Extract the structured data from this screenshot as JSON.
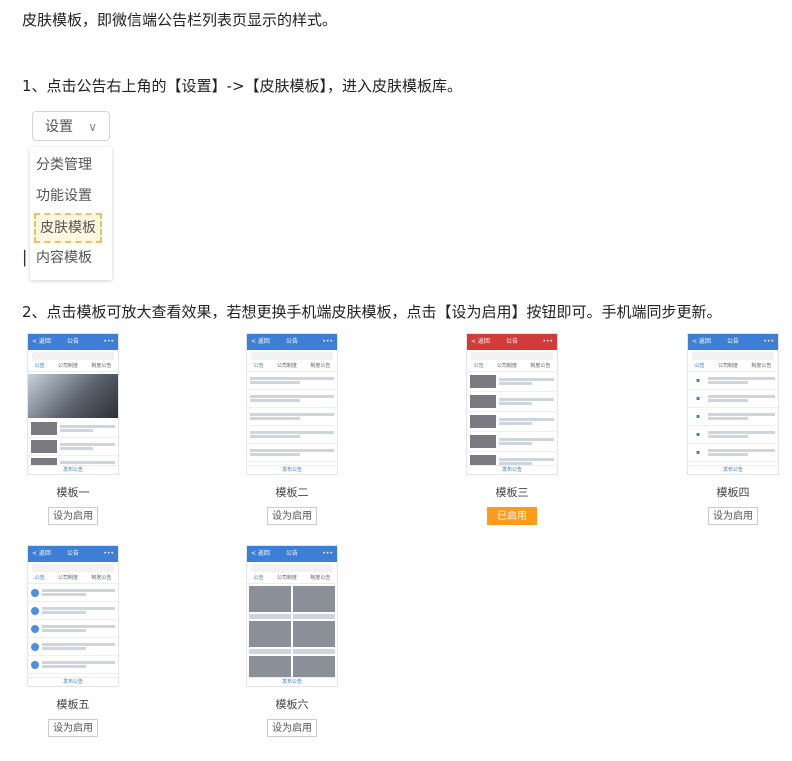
{
  "intro": "皮肤模板，即微信端公告栏列表页显示的样式。",
  "step1": "1、点击公告右上角的【设置】->【皮肤模板】，进入皮肤模板库。",
  "settings": {
    "button_label": "设置",
    "chevron": "∨",
    "menu": [
      "分类管理",
      "功能设置",
      "皮肤模板",
      "内容模板"
    ],
    "highlighted_index": 2
  },
  "step2": "2、点击模板可放大查看效果，若想更换手机端皮肤模板，点击【设为启用】按钮即可。手机端同步更新。",
  "phone": {
    "back": "< 返回",
    "title": "公告",
    "more": "•••",
    "tabs": [
      "公告",
      "公司制度",
      "制度公告"
    ],
    "footer": "发布公告"
  },
  "templates": [
    {
      "name": "模板一",
      "button": "设为启用",
      "active": false
    },
    {
      "name": "模板二",
      "button": "设为启用",
      "active": false
    },
    {
      "name": "模板三",
      "button": "已启用",
      "active": true
    },
    {
      "name": "模板四",
      "button": "设为启用",
      "active": false
    },
    {
      "name": "模板五",
      "button": "设为启用",
      "active": false
    },
    {
      "name": "模板六",
      "button": "设为启用",
      "active": false
    }
  ],
  "colors": {
    "accent": "#3d7fd6",
    "active_button": "#ff9a1a",
    "highlight_border": "#f0c060"
  }
}
